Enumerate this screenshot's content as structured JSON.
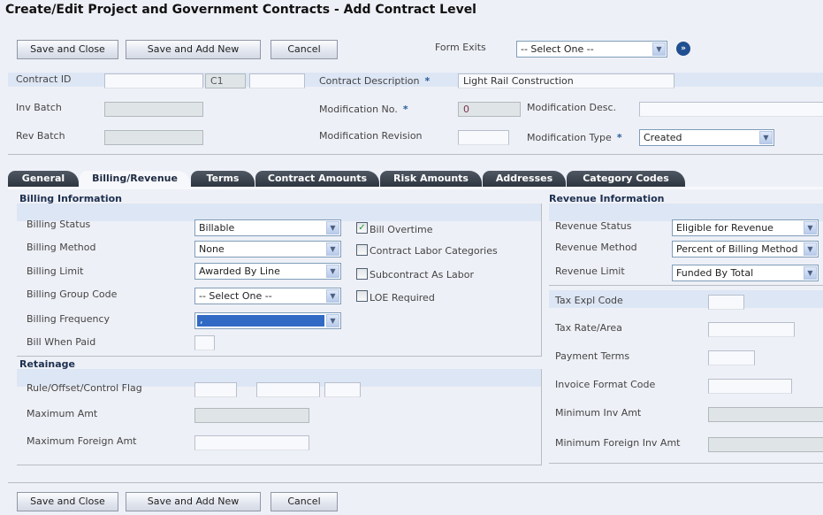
{
  "title": "Create/Edit Project and Government Contracts - Add Contract Level",
  "toolbar": {
    "save_close": "Save and Close",
    "save_add": "Save and Add New",
    "cancel": "Cancel",
    "form_exits_label": "Form Exits",
    "form_exits_value": "-- Select One --",
    "go_icon": "double-chevron-right-icon"
  },
  "header": {
    "contract_id_label": "Contract ID",
    "contract_id_1": "",
    "contract_id_2": "C1",
    "contract_id_3": "",
    "contract_desc_label": "Contract Description",
    "contract_desc_value": "Light Rail Construction",
    "inv_batch_label": "Inv Batch",
    "rev_batch_label": "Rev Batch",
    "mod_no_label": "Modification No.",
    "mod_no_value": "0",
    "mod_desc_label": "Modification Desc.",
    "mod_desc_value": "",
    "mod_rev_label": "Modification Revision",
    "mod_rev_value": "",
    "mod_type_label": "Modification Type",
    "mod_type_value": "Created",
    "required_mark": "*"
  },
  "tabs": [
    "General",
    "Billing/Revenue",
    "Terms",
    "Contract Amounts",
    "Risk Amounts",
    "Addresses",
    "Category Codes"
  ],
  "active_tab": "Billing/Revenue",
  "billing": {
    "title": "Billing Information",
    "status_label": "Billing Status",
    "status_value": "Billable",
    "method_label": "Billing Method",
    "method_value": "None",
    "limit_label": "Billing Limit",
    "limit_value": "Awarded By Line",
    "group_label": "Billing Group Code",
    "group_value": "-- Select One --",
    "freq_label": "Billing Frequency",
    "freq_value": ",",
    "when_paid_label": "Bill When Paid",
    "when_paid_value": "",
    "checkboxes": [
      {
        "label": "Bill Overtime",
        "checked": true
      },
      {
        "label": "Contract Labor Categories",
        "checked": false
      },
      {
        "label": "Subcontract As Labor",
        "checked": false
      },
      {
        "label": "LOE Required",
        "checked": false
      }
    ]
  },
  "retainage": {
    "title": "Retainage",
    "rule_label": "Rule/Offset/Control Flag",
    "max_label": "Maximum Amt",
    "max_foreign_label": "Maximum Foreign Amt"
  },
  "revenue": {
    "title": "Revenue Information",
    "status_label": "Revenue Status",
    "status_value": "Eligible for Revenue",
    "method_label": "Revenue Method",
    "method_value": "Percent of Billing Method",
    "limit_label": "Revenue Limit",
    "limit_value": "Funded By Total",
    "tax_expl_label": "Tax Expl Code",
    "tax_rate_label": "Tax Rate/Area",
    "pay_terms_label": "Payment Terms",
    "inv_format_label": "Invoice Format Code",
    "min_inv_label": "Minimum Inv Amt",
    "min_foreign_label": "Minimum Foreign Inv Amt"
  },
  "colors": {
    "accent": "#2a5d9a",
    "tab_dark": "#2e3640",
    "band": "#dde6f4",
    "selected": "#316ac5"
  }
}
